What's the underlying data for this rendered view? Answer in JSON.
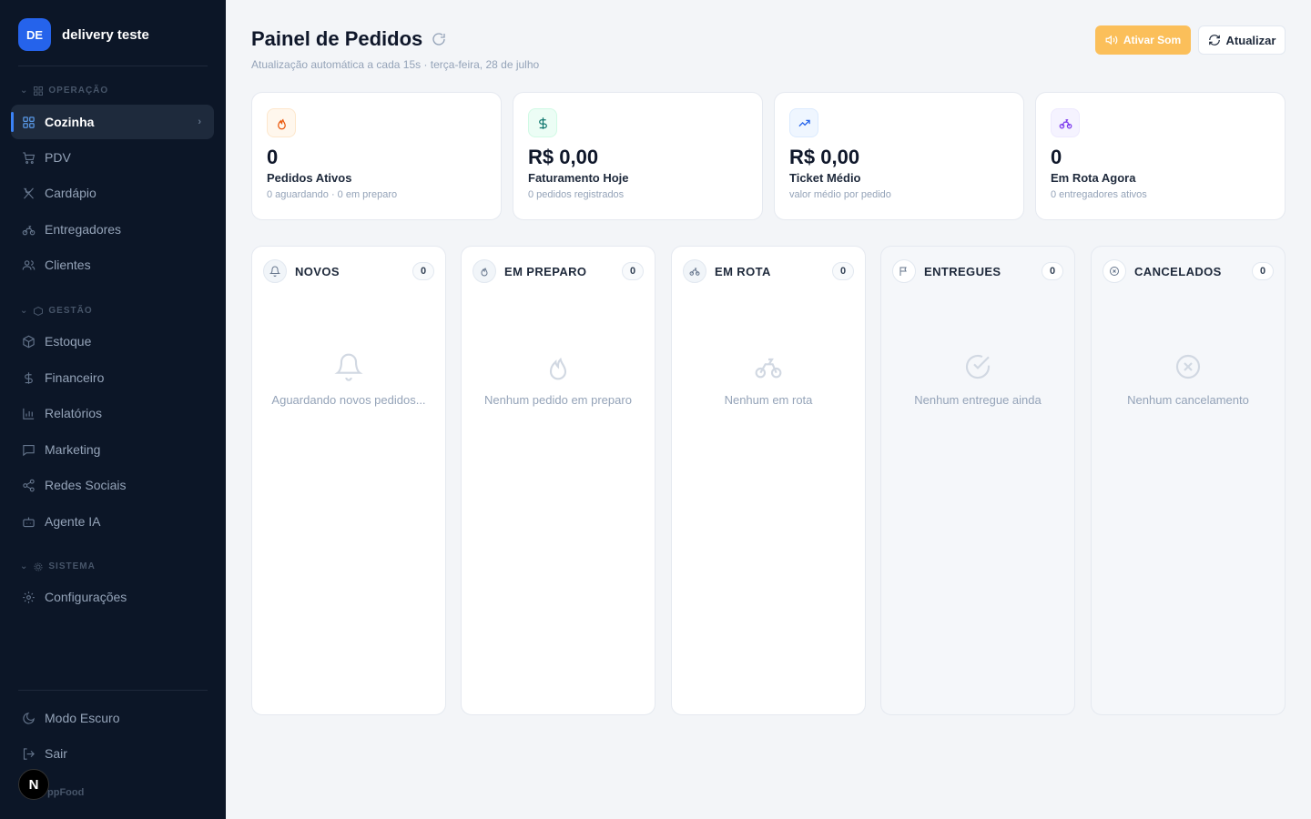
{
  "brand": {
    "initials": "DE",
    "name": "delivery teste"
  },
  "sidebar": {
    "sections": [
      {
        "label": "OPERAÇÃO"
      },
      {
        "label": "GESTÃO"
      },
      {
        "label": "SISTEMA"
      }
    ],
    "items": [
      {
        "label": "Cozinha",
        "icon": "grid-icon",
        "active": true
      },
      {
        "label": "PDV",
        "icon": "cart-icon"
      },
      {
        "label": "Cardápio",
        "icon": "utensils-icon"
      },
      {
        "label": "Entregadores",
        "icon": "bike-icon"
      },
      {
        "label": "Clientes",
        "icon": "users-icon"
      },
      {
        "label": "Estoque",
        "icon": "box-icon"
      },
      {
        "label": "Financeiro",
        "icon": "dollar-icon"
      },
      {
        "label": "Relatórios",
        "icon": "bar-chart-icon"
      },
      {
        "label": "Marketing",
        "icon": "message-icon"
      },
      {
        "label": "Redes Sociais",
        "icon": "share-icon"
      },
      {
        "label": "Agente IA",
        "icon": "bot-icon"
      },
      {
        "label": "Configurações",
        "icon": "gear-icon"
      }
    ],
    "footer": {
      "dark_mode": "Modo Escuro",
      "logout": "Sair",
      "app_name": "ppFood",
      "badge": "N"
    }
  },
  "header": {
    "title": "Painel de Pedidos",
    "subtitle": "Atualização automática a cada 15s · terça-feira, 28 de julho",
    "sound_button": "Ativar Som",
    "refresh_button": "Atualizar"
  },
  "stats": [
    {
      "value": "0",
      "label": "Pedidos Ativos",
      "sub": "0 aguardando · 0 em preparo",
      "icon": "flame-icon",
      "color": "#ea580c",
      "bg": "#fff7ed"
    },
    {
      "value": "R$ 0,00",
      "label": "Faturamento Hoje",
      "sub": "0 pedidos registrados",
      "icon": "dollar-icon",
      "color": "#0f766e",
      "bg": "#ecfdf5"
    },
    {
      "value": "R$ 0,00",
      "label": "Ticket Médio",
      "sub": "valor médio por pedido",
      "icon": "trending-up-icon",
      "color": "#2563eb",
      "bg": "#eff6ff"
    },
    {
      "value": "0",
      "label": "Em Rota Agora",
      "sub": "0 entregadores ativos",
      "icon": "bike-icon",
      "color": "#7c3aed",
      "bg": "#f5f3ff"
    }
  ],
  "columns": [
    {
      "title": "NOVOS",
      "count": "0",
      "empty": "Aguardando novos pedidos...",
      "icon": "bell-icon"
    },
    {
      "title": "EM PREPARO",
      "count": "0",
      "empty": "Nenhum pedido em preparo",
      "icon": "flame-icon"
    },
    {
      "title": "EM ROTA",
      "count": "0",
      "empty": "Nenhum em rota",
      "icon": "bike-icon"
    },
    {
      "title": "ENTREGUES",
      "count": "0",
      "empty": "Nenhum entregue ainda",
      "icon": "flag-icon"
    },
    {
      "title": "CANCELADOS",
      "count": "0",
      "empty": "Nenhum cancelamento",
      "icon": "x-circle-icon"
    }
  ]
}
